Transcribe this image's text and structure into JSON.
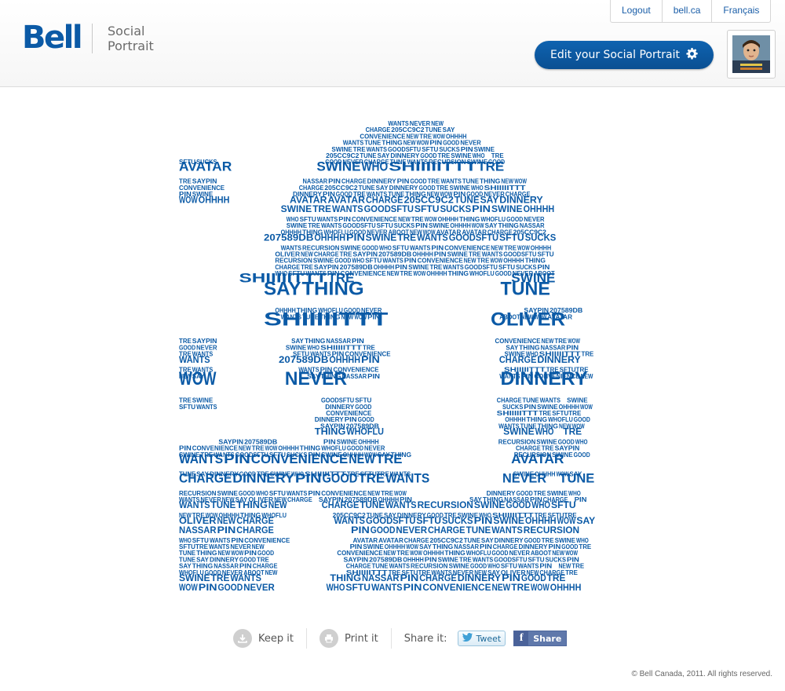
{
  "brand": {
    "logo": "Bell",
    "product_line1": "Social",
    "product_line2": "Portrait",
    "accent": "#0b5aa6"
  },
  "toplinks": [
    "Logout",
    "bell.ca",
    "Français"
  ],
  "edit_button": {
    "label": "Edit your Social Portrait",
    "icon": "gear-icon"
  },
  "avatar": {
    "icon": "profile-photo"
  },
  "portrait": {
    "words": [
      "NEVER",
      "CHARGE",
      "TUNE",
      "WANTS",
      "RECURSION",
      "SWINE",
      "GOOD",
      "WHO",
      "SFTU",
      "WANTS",
      "PIN",
      "CONVENIENCE",
      "NEW",
      "TRE",
      "WOW",
      "OHHHH",
      "THING",
      "WHOFLU",
      "GOOD",
      "NEVER",
      "ABOOT",
      "NEW",
      "WOW",
      "AVATAR",
      "AVATAR",
      "CHARGE",
      "205CC9C2",
      "TUNE",
      "SAY",
      "DINNERY",
      "GOOD",
      "TRE",
      "SWINE",
      "WHO",
      "SHIIIIITTT",
      "TRE",
      "SFTUTRE",
      "WANTS",
      "NEVER",
      "NEW",
      "SAY",
      "OLIVER",
      "NEW",
      "CHARGE",
      "TRE",
      "SAYPIN",
      "207589DB",
      "OHHHH",
      "PIN",
      "SWINE",
      "TRE",
      "WANTS",
      "GOODSFTU",
      "SFTU",
      "SUCKS",
      "PIN",
      "SWINE",
      "OHHHH",
      "WOW",
      "SAY",
      "THING",
      "NASSAR",
      "PIN",
      "CHARGE",
      "DINNERY",
      "PIN",
      "GOOD",
      "TRE",
      "WANTS",
      "TUNE",
      "THING",
      "NEW",
      "WOW",
      "PIN",
      "GOOD"
    ]
  },
  "actions": {
    "keep_label": "Keep it",
    "print_label": "Print it",
    "share_label": "Share it:",
    "tweet_label": "Tweet",
    "share_fb_label": "Share"
  },
  "footer": {
    "copyright": "© Bell Canada, 2011. All rights reserved."
  }
}
